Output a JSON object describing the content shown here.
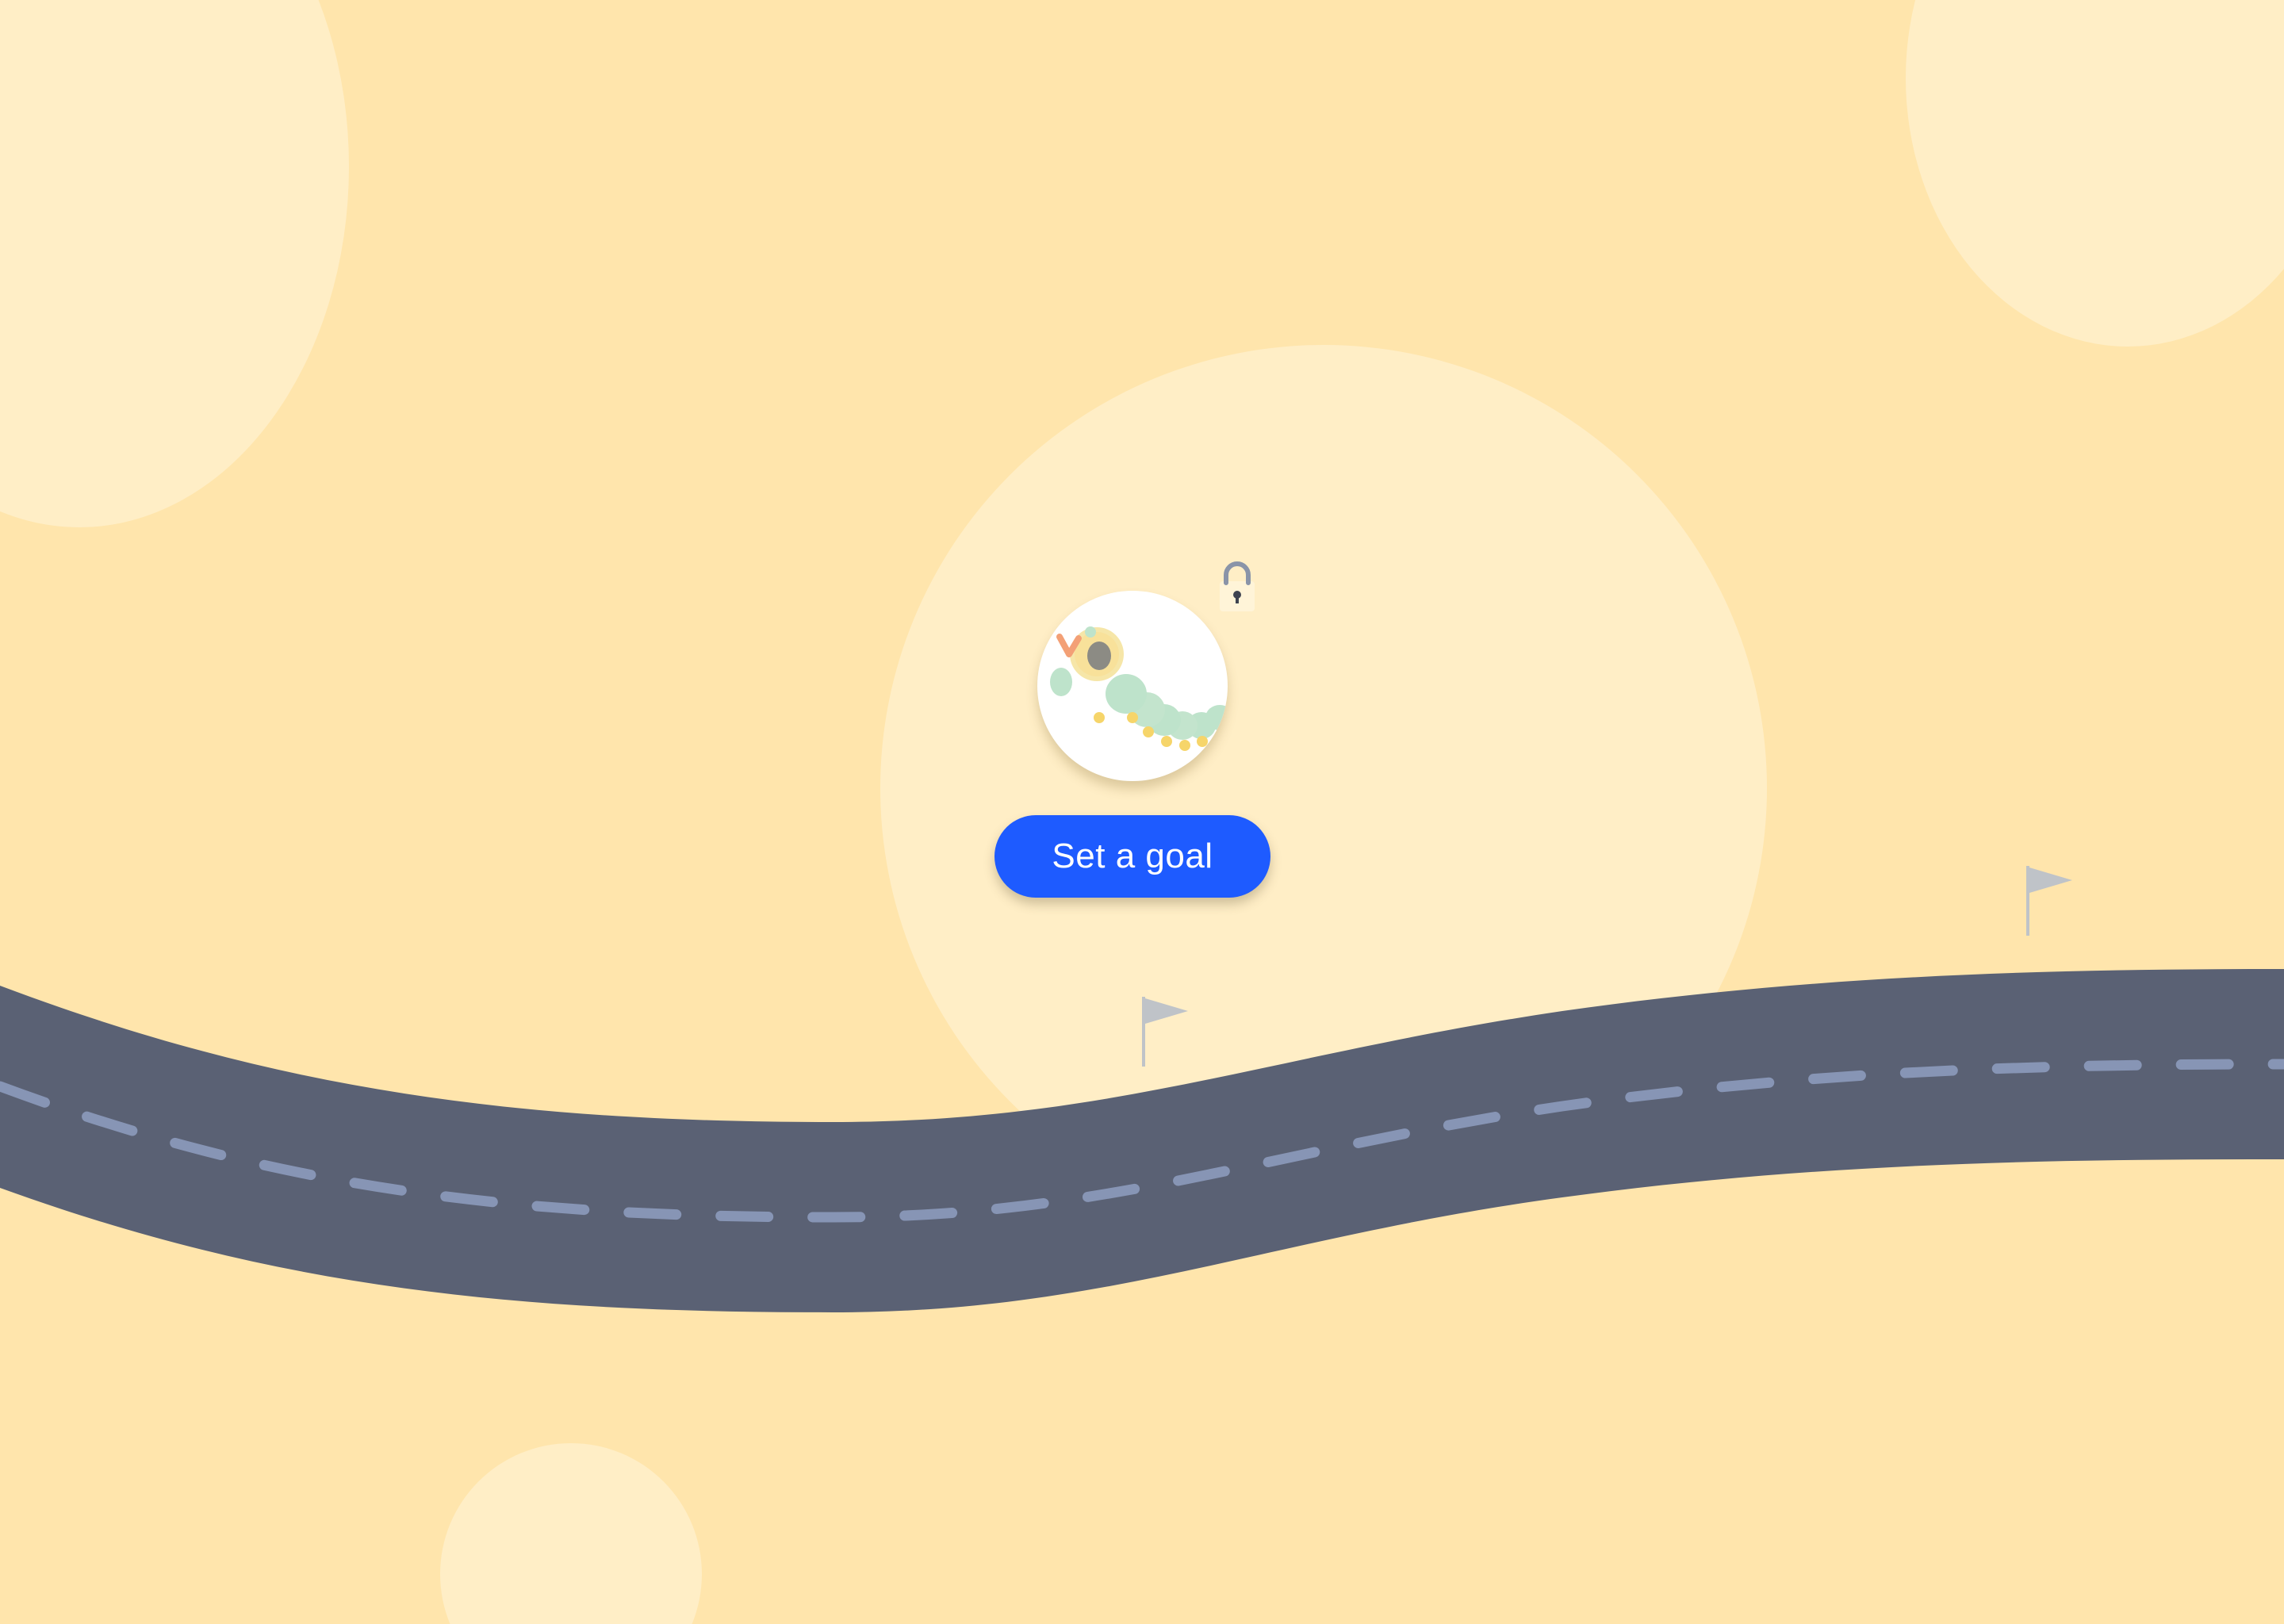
{
  "goal_button": {
    "label": "Set a goal"
  },
  "avatar": {
    "icon": "caterpillar-icon",
    "locked": true,
    "lock_icon": "padlock-icon"
  },
  "milestones": {
    "flag_icon": "flag-icon",
    "count": 2
  },
  "colors": {
    "background": "#FFE5AC",
    "bubble": "#FFEEC6",
    "road": "#5A6174",
    "road_dash": "#8795B5",
    "button": "#1E5BFF",
    "flag": "#BFC3C8"
  }
}
